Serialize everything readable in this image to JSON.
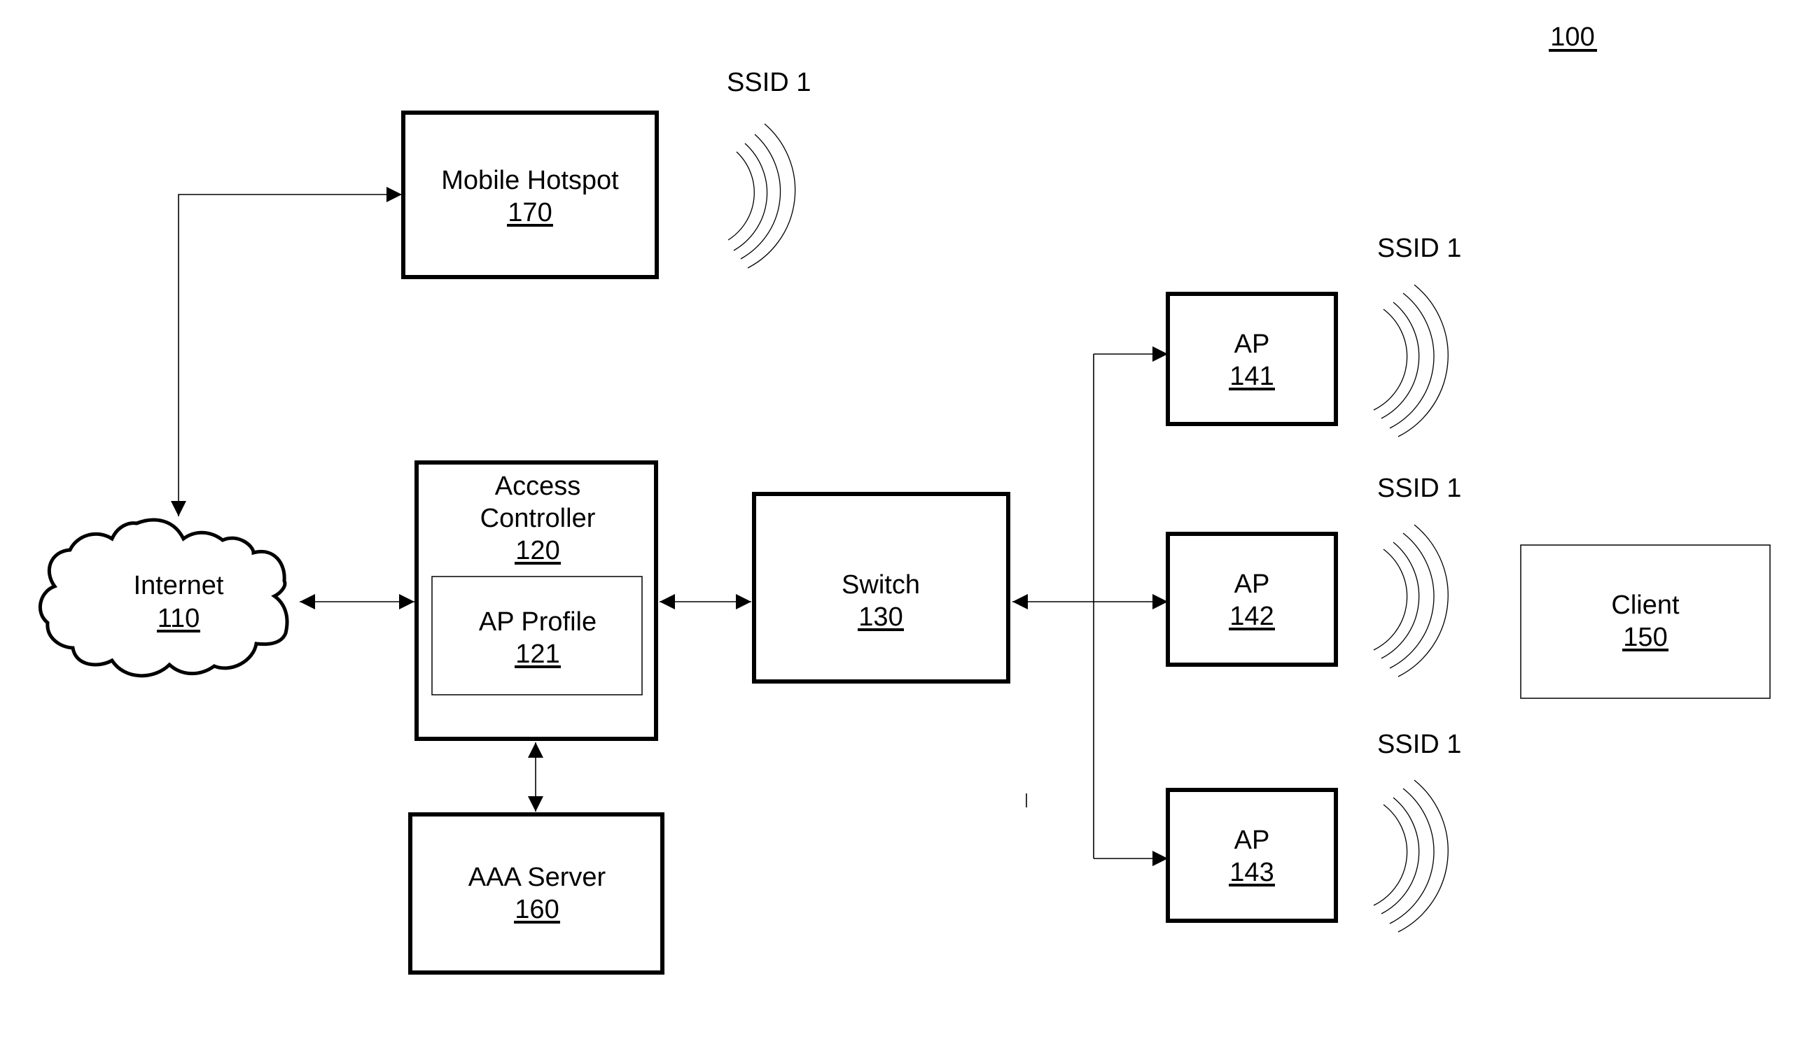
{
  "figure": {
    "number": "100"
  },
  "nodes": {
    "internet": {
      "label": "Internet",
      "ref": "110"
    },
    "access_controller": {
      "label_line1": "Access",
      "label_line2": "Controller",
      "ref": "120"
    },
    "ap_profile": {
      "label": "AP Profile",
      "ref": "121"
    },
    "switch": {
      "label": "Switch",
      "ref": "130"
    },
    "ap141": {
      "label": "AP",
      "ref": "141"
    },
    "ap142": {
      "label": "AP",
      "ref": "142"
    },
    "ap143": {
      "label": "AP",
      "ref": "143"
    },
    "client": {
      "label": "Client",
      "ref": "150"
    },
    "aaa_server": {
      "label": "AAA Server",
      "ref": "160"
    },
    "mobile_hotspot": {
      "label": "Mobile Hotspot",
      "ref": "170"
    }
  },
  "ssid_labels": {
    "hotspot": "SSID 1",
    "ap141": "SSID 1",
    "ap142": "SSID 1",
    "ap143": "SSID 1"
  },
  "connections": [
    {
      "from": "internet",
      "to": "mobile_hotspot",
      "bidirectional": true
    },
    {
      "from": "internet",
      "to": "access_controller",
      "bidirectional": true
    },
    {
      "from": "access_controller",
      "to": "switch",
      "bidirectional": true
    },
    {
      "from": "access_controller",
      "to": "aaa_server",
      "bidirectional": true
    },
    {
      "from": "switch",
      "to": "ap141",
      "bidirectional": false
    },
    {
      "from": "switch",
      "to": "ap142",
      "bidirectional": false
    },
    {
      "from": "switch",
      "to": "ap143",
      "bidirectional": false
    }
  ]
}
